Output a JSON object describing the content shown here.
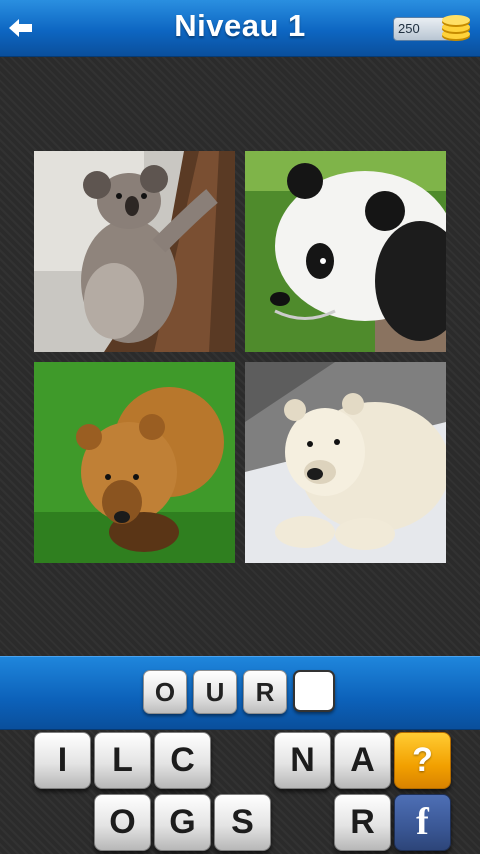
{
  "header": {
    "title": "Niveau 1",
    "coins": "250",
    "back_icon": "arrow-left-icon",
    "coin_icon": "gold-coins-icon"
  },
  "photos": [
    {
      "subject": "koala"
    },
    {
      "subject": "panda"
    },
    {
      "subject": "brown bear"
    },
    {
      "subject": "polar bear"
    }
  ],
  "answer": {
    "letters": [
      "O",
      "U",
      "R",
      ""
    ]
  },
  "keyboard": {
    "row1": [
      "I",
      "L",
      "C",
      "",
      "N",
      "A"
    ],
    "row2": [
      "O",
      "G",
      "S",
      "",
      "R"
    ],
    "hint_label": "?",
    "facebook_label": "f"
  },
  "colors": {
    "bar_blue": "#0d66c2",
    "hint_orange": "#f2a000",
    "facebook_blue": "#3a5795"
  }
}
